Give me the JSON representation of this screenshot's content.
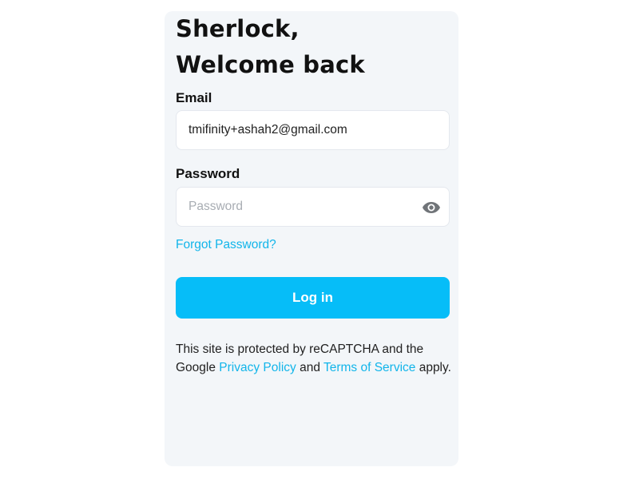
{
  "login": {
    "greeting_line1": "Sherlock,",
    "greeting_line2": "Welcome back",
    "email_label": "Email",
    "email_value": "tmifinity+ashah2@gmail.com",
    "password_label": "Password",
    "password_value": "",
    "password_placeholder": "Password",
    "show_password_icon": "eye-icon",
    "forgot_link": "Forgot Password?",
    "login_button": "Log in",
    "recaptcha_text_1": "This site is protected by reCAPTCHA and the Google ",
    "privacy_link": "Privacy Policy",
    "recaptcha_text_2": " and ",
    "terms_link": "Terms of Service",
    "recaptcha_text_3": " apply."
  },
  "colors": {
    "accent": "#06bdf8",
    "link": "#12b5ea",
    "card_background": "#f3f6f9"
  }
}
